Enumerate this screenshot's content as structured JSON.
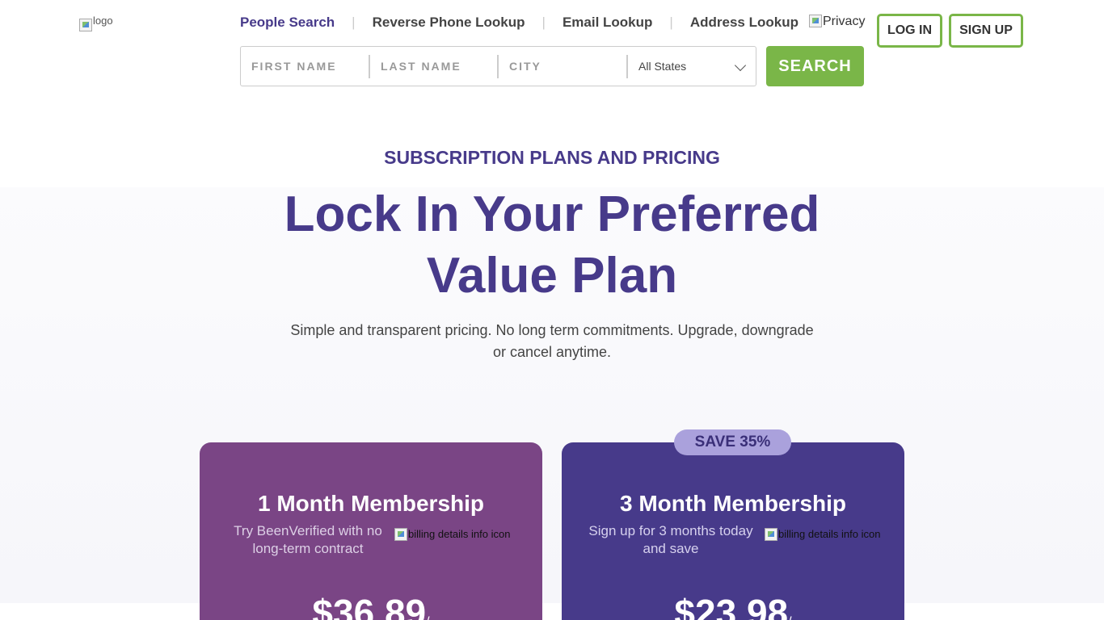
{
  "header": {
    "logo_alt": "logo",
    "nav": [
      {
        "label": "People Search",
        "active": true
      },
      {
        "label": "Reverse Phone Lookup",
        "active": false
      },
      {
        "label": "Email Lookup",
        "active": false
      },
      {
        "label": "Address Lookup",
        "active": false
      }
    ],
    "privacy_alt": "Privacy",
    "login_label": "LOG IN",
    "signup_label": "SIGN UP"
  },
  "search": {
    "first_name_placeholder": "FIRST NAME",
    "last_name_placeholder": "LAST NAME",
    "city_placeholder": "CITY",
    "state_selected": "All States",
    "search_label": "SEARCH"
  },
  "hero": {
    "section_title": "SUBSCRIPTION PLANS AND PRICING",
    "headline_light": "Lock In Your ",
    "headline_bold": "Preferred Value Plan",
    "subtitle": "Simple and transparent pricing. No long term commitments. Upgrade, downgrade or cancel anytime."
  },
  "plans": [
    {
      "title": "1 Month Membership",
      "description": "Try BeenVerified with no long-term contract",
      "info_icon_alt": "billing details info icon",
      "price": "$36.89",
      "price_suffix": "/",
      "color": "#7a4585"
    },
    {
      "badge": "SAVE 35%",
      "title": "3 Month Membership",
      "description": "Sign up for 3 months today and save",
      "info_icon_alt": "billing details info icon",
      "price": "$23.98",
      "price_suffix": "/",
      "color": "#473a8a"
    }
  ],
  "colors": {
    "brand_purple": "#473a8a",
    "accent_green": "#7ab648",
    "plan_magenta": "#7a4585",
    "badge_lavender": "#aaa1dc"
  }
}
